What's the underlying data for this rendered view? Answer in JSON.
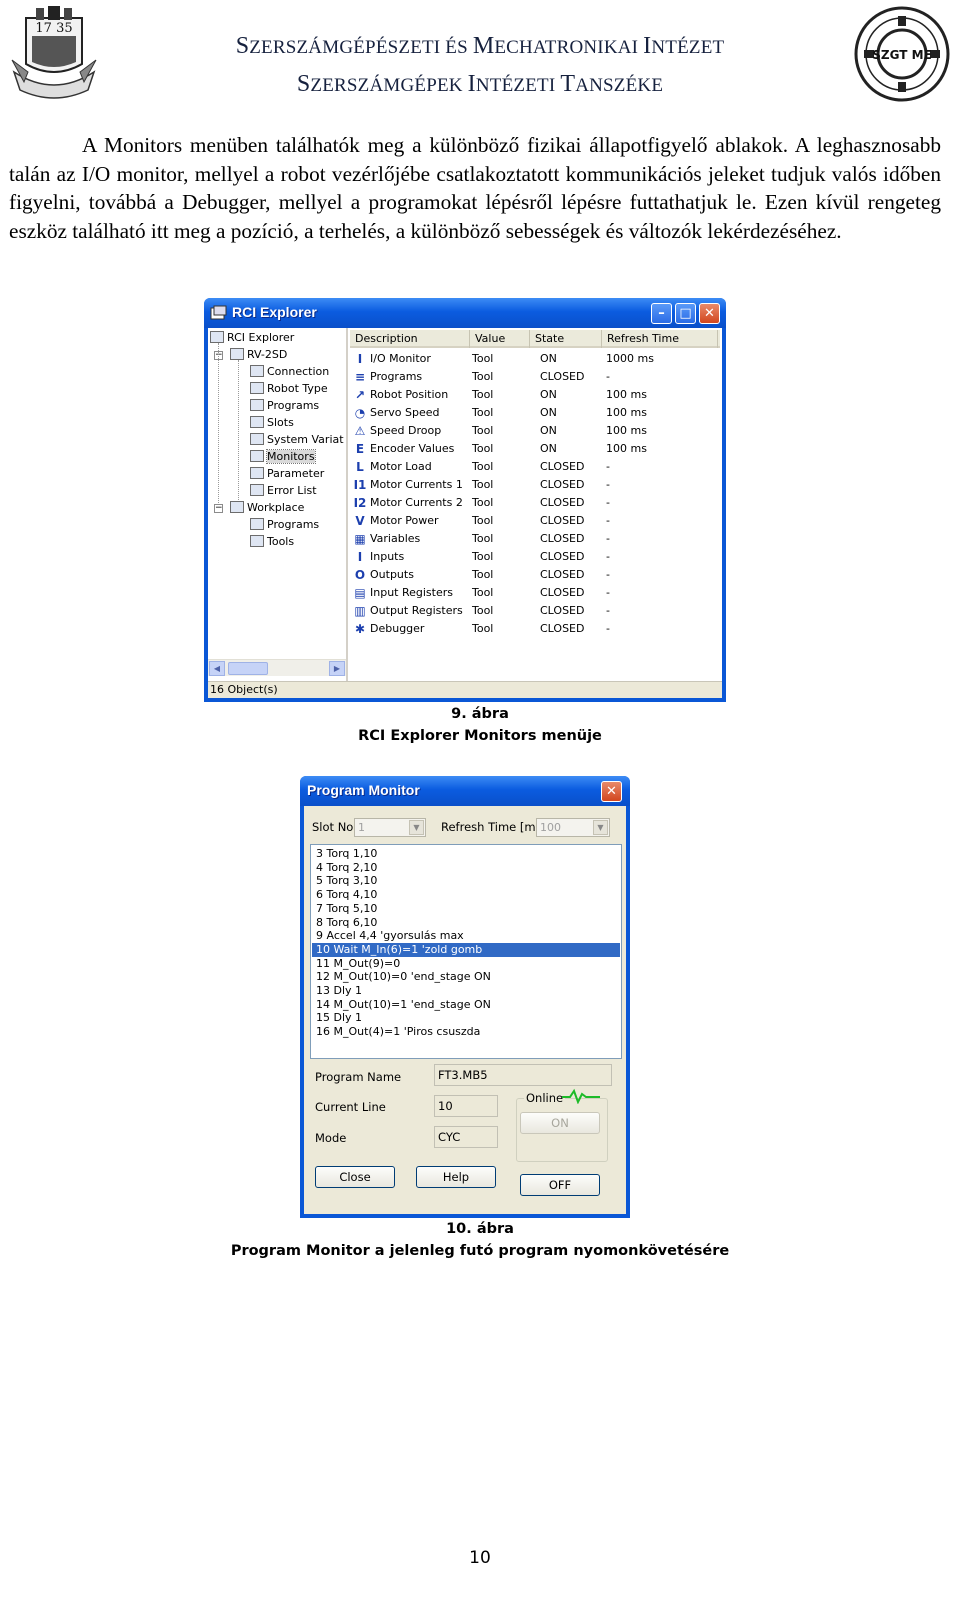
{
  "header": {
    "line1_caps": [
      "S",
      "ZERSZÁMGÉPÉSZETI ÉS ",
      "M",
      "ECHATRONIKAI ",
      "I",
      "NTÉZET"
    ],
    "line2_caps": [
      "S",
      "ZERSZÁMGÉPEK ",
      "I",
      "NTÉZETI ",
      "T",
      "ANSZÉKE"
    ],
    "logo_left_text": "17 35",
    "logo_right_text": "SZGT ME"
  },
  "paragraph": "A Monitors menüben találhatók meg a különböző fizikai állapotfigyelő ablakok. A leghasznosabb talán az I/O monitor, mellyel a robot vezérlőjébe csatlakoztatott kommunikációs jeleket tudjuk valós időben figyelni, továbbá a Debugger, mellyel a programokat lépésről lépésre futtathatjuk le. Ezen kívül rengeteg eszköz található itt meg a pozíció, a terhelés, a különböző sebességek és változók lekérdezéséhez.",
  "rci_window": {
    "title": "RCI Explorer",
    "tree": [
      {
        "label": "RCI Explorer",
        "level": 0
      },
      {
        "label": "RV-2SD",
        "level": 1
      },
      {
        "label": "Connection",
        "level": 2
      },
      {
        "label": "Robot Type",
        "level": 2
      },
      {
        "label": "Programs",
        "level": 2
      },
      {
        "label": "Slots",
        "level": 2
      },
      {
        "label": "System Variat",
        "level": 2
      },
      {
        "label": "Monitors",
        "level": 2
      },
      {
        "label": "Parameter",
        "level": 2
      },
      {
        "label": "Error List",
        "level": 2
      },
      {
        "label": "Workplace",
        "level": 1
      },
      {
        "label": "Programs",
        "level": 2
      },
      {
        "label": "Tools",
        "level": 2
      }
    ],
    "columns": [
      "Description",
      "Value",
      "State",
      "Refresh Time"
    ],
    "rows": [
      {
        "icon": "I",
        "desc": "I/O Monitor",
        "value": "Tool",
        "state": "ON",
        "refresh": "1000 ms"
      },
      {
        "icon": "≡",
        "desc": "Programs",
        "value": "Tool",
        "state": "CLOSED",
        "refresh": "-"
      },
      {
        "icon": "↗",
        "desc": "Robot Position",
        "value": "Tool",
        "state": "ON",
        "refresh": "100 ms"
      },
      {
        "icon": "◔",
        "desc": "Servo Speed",
        "value": "Tool",
        "state": "ON",
        "refresh": "100 ms"
      },
      {
        "icon": "⚠",
        "desc": "Speed Droop",
        "value": "Tool",
        "state": "ON",
        "refresh": "100 ms"
      },
      {
        "icon": "E",
        "desc": "Encoder Values",
        "value": "Tool",
        "state": "ON",
        "refresh": "100 ms"
      },
      {
        "icon": "L",
        "desc": "Motor Load",
        "value": "Tool",
        "state": "CLOSED",
        "refresh": "-"
      },
      {
        "icon": "I1",
        "desc": "Motor Currents 1",
        "value": "Tool",
        "state": "CLOSED",
        "refresh": "-"
      },
      {
        "icon": "I2",
        "desc": "Motor Currents 2",
        "value": "Tool",
        "state": "CLOSED",
        "refresh": "-"
      },
      {
        "icon": "V",
        "desc": "Motor Power",
        "value": "Tool",
        "state": "CLOSED",
        "refresh": "-"
      },
      {
        "icon": "▦",
        "desc": "Variables",
        "value": "Tool",
        "state": "CLOSED",
        "refresh": "-"
      },
      {
        "icon": "I",
        "desc": "Inputs",
        "value": "Tool",
        "state": "CLOSED",
        "refresh": "-"
      },
      {
        "icon": "O",
        "desc": "Outputs",
        "value": "Tool",
        "state": "CLOSED",
        "refresh": "-"
      },
      {
        "icon": "▤",
        "desc": "Input Registers",
        "value": "Tool",
        "state": "CLOSED",
        "refresh": "-"
      },
      {
        "icon": "▥",
        "desc": "Output Registers",
        "value": "Tool",
        "state": "CLOSED",
        "refresh": "-"
      },
      {
        "icon": "✱",
        "desc": "Debugger",
        "value": "Tool",
        "state": "CLOSED",
        "refresh": "-"
      }
    ],
    "status": "16 Object(s)"
  },
  "caption9": {
    "number": "9. ábra",
    "text": "RCI Explorer Monitors menüje"
  },
  "program_monitor": {
    "title": "Program Monitor",
    "slot_label": "Slot No",
    "slot_value": "1",
    "refresh_label": "Refresh Time [ms]",
    "refresh_value": "100",
    "lines": [
      "3 Torq 1,10",
      "4 Torq 2,10",
      "5 Torq 3,10",
      "6 Torq 4,10",
      "7 Torq 5,10",
      "8 Torq 6,10",
      "9 Accel 4,4 'gyorsulás max",
      "10 Wait M_In(6)=1  'zold gomb",
      "11 M_Out(9)=0",
      "12 M_Out(10)=0  'end_stage ON",
      "13 Dly 1",
      "14 M_Out(10)=1   'end_stage ON",
      "15 Dly 1",
      "16 M_Out(4)=1  'Piros csuszda"
    ],
    "selected_index": 7,
    "program_name_label": "Program Name",
    "program_name": "FT3.MB5",
    "current_line_label": "Current Line",
    "current_line": "10",
    "mode_label": "Mode",
    "mode": "CYC",
    "online_label": "Online",
    "on_label": "ON",
    "off_label": "OFF",
    "close_label": "Close",
    "help_label": "Help"
  },
  "caption10": {
    "number": "10. ábra",
    "text": "Program Monitor a jelenleg futó program nyomonkövetésére"
  },
  "page_number": "10"
}
